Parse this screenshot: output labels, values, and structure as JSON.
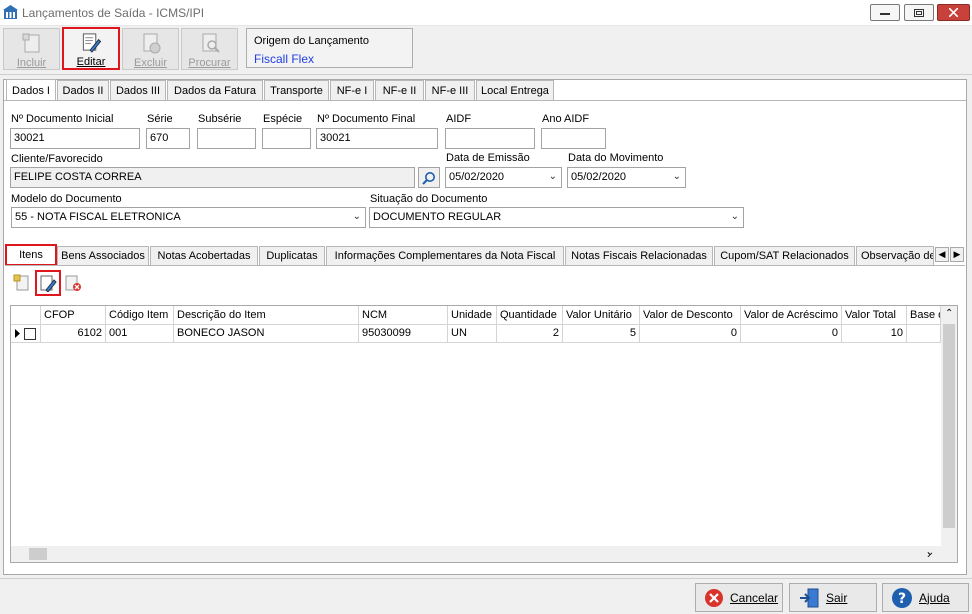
{
  "window": {
    "title": "Lançamentos de Saída - ICMS/IPI"
  },
  "toolbar": {
    "incluir": "Incluir",
    "editar": "Editar",
    "excluir": "Excluir",
    "procurar": "Procurar"
  },
  "origem": {
    "label": "Origem do Lançamento",
    "value": "Fiscall Flex"
  },
  "tabs": [
    "Dados I",
    "Dados II",
    "Dados III",
    "Dados da Fatura",
    "Transporte",
    "NF-e I",
    "NF-e II",
    "NF-e III",
    "Local Entrega"
  ],
  "form": {
    "num_doc_inicial": {
      "label": "Nº Documento Inicial",
      "value": "30021"
    },
    "serie": {
      "label": "Série",
      "value": "670"
    },
    "subserie": {
      "label": "Subsérie",
      "value": ""
    },
    "especie": {
      "label": "Espécie",
      "value": ""
    },
    "num_doc_final": {
      "label": "Nº Documento Final",
      "value": "30021"
    },
    "aidf": {
      "label": "AIDF",
      "value": ""
    },
    "ano_aidf": {
      "label": "Ano AIDF",
      "value": ""
    },
    "cliente": {
      "label": "Cliente/Favorecido",
      "value": "FELIPE COSTA CORREA"
    },
    "data_emissao": {
      "label": "Data de Emissão",
      "value": "05/02/2020"
    },
    "data_movimento": {
      "label": "Data do Movimento",
      "value": "05/02/2020"
    },
    "modelo": {
      "label": "Modelo do Documento",
      "value": "55 - NOTA FISCAL ELETRONICA"
    },
    "situacao": {
      "label": "Situação do Documento",
      "value": "DOCUMENTO REGULAR"
    }
  },
  "subtabs": [
    "Itens",
    "Bens Associados",
    "Notas Acobertadas",
    "Duplicatas",
    "Informações Complementares da Nota Fiscal",
    "Notas Fiscais Relacionadas",
    "Cupom/SAT Relacionados",
    "Observação de"
  ],
  "grid": {
    "columns": [
      "CFOP",
      "Código Item",
      "Descrição do Item",
      "NCM",
      "Unidade",
      "Quantidade",
      "Valor Unitário",
      "Valor de Desconto",
      "Valor de Acréscimo",
      "Valor Total",
      "Base d"
    ],
    "rows": [
      {
        "cfop": "6102",
        "codigo": "001",
        "descricao": "BONECO JASON",
        "ncm": "95030099",
        "unidade": "UN",
        "quantidade": "2",
        "valor_unitario": "5",
        "desconto": "0",
        "acrescimo": "0",
        "total": "10",
        "base": ""
      }
    ]
  },
  "footer": {
    "cancelar": "Cancelar",
    "sair": "Sair",
    "ajuda": "Ajuda"
  },
  "colors": {
    "highlight": "#e0161d",
    "link_blue": "#1f3ee0"
  }
}
